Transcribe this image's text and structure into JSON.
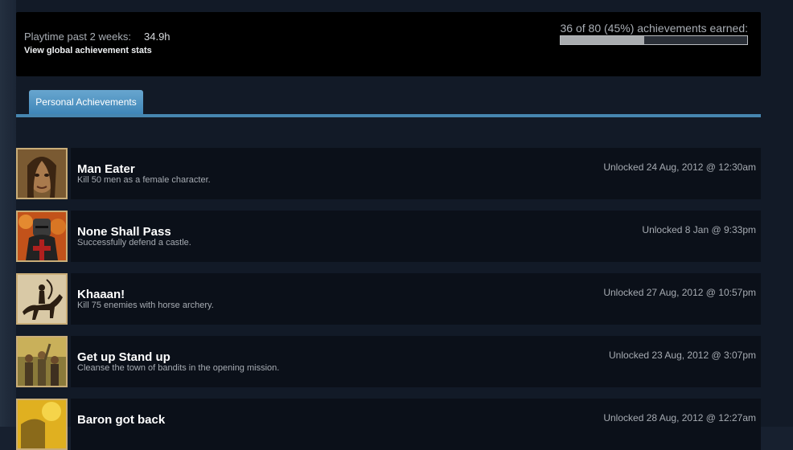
{
  "header": {
    "playtime_label": "Playtime past 2 weeks:",
    "playtime_value": "34.9h",
    "global_stats_link": "View global achievement stats",
    "achievements_summary": "36 of 80 (45%) achievements earned:",
    "progress_fraction": 0.45
  },
  "tabs": {
    "personal": "Personal Achievements"
  },
  "achievements": [
    {
      "title": "Man Eater",
      "description": "Kill 50 men as a female character.",
      "unlocked": "Unlocked 24 Aug, 2012 @ 12:30am",
      "icon": "female-warrior-icon"
    },
    {
      "title": "None Shall Pass",
      "description": "Successfully defend a castle.",
      "unlocked": "Unlocked 8 Jan @ 9:33pm",
      "icon": "knight-icon"
    },
    {
      "title": "Khaaan!",
      "description": "Kill 75 enemies with horse archery.",
      "unlocked": "Unlocked 27 Aug, 2012 @ 10:57pm",
      "icon": "horse-archer-icon"
    },
    {
      "title": "Get up Stand up",
      "description": "Cleanse the town of bandits in the opening mission.",
      "unlocked": "Unlocked 23 Aug, 2012 @ 3:07pm",
      "icon": "townsfolk-icon"
    },
    {
      "title": "Baron got back",
      "description": "",
      "unlocked": "Unlocked 28 Aug, 2012 @ 12:27am",
      "icon": "baron-icon"
    }
  ],
  "colors": {
    "background": "#121a27",
    "tab_accent": "#4686b0",
    "row_background": "#0b1019",
    "icon_border": "#c9ad78"
  }
}
